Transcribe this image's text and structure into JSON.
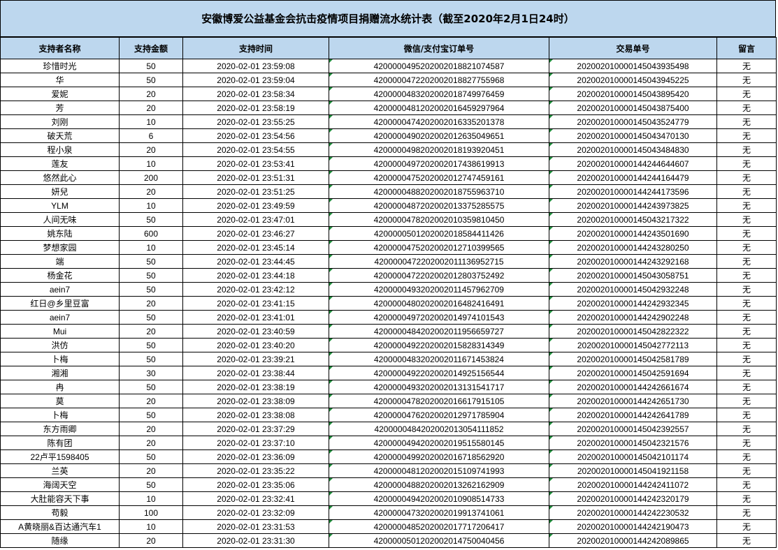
{
  "title": "安徽博爱公益基金会抗击疫情项目捐赠流水统计表（截至2020年2月1日24时）",
  "columns": [
    "支持者名称",
    "支持金额",
    "支持时间",
    "微信/支付宝订单号",
    "交易单号",
    "留言"
  ],
  "rows": [
    [
      "珍惜时光",
      "50",
      "2020-02-01 23:59:08",
      "4200000495202002018821074587",
      "2020020100001450439354​98",
      "无"
    ],
    [
      "华",
      "50",
      "2020-02-01 23:59:04",
      "4200000472202002018827755968",
      "20200201000014504394522​5",
      "无"
    ],
    [
      "爱妮",
      "20",
      "2020-02-01 23:58:34",
      "4200000483202002018749976459",
      "202002010000145043895420",
      "无"
    ],
    [
      "芳",
      "20",
      "2020-02-01 23:58:19",
      "4200000481202002016459297964",
      "202002010000145043875400",
      "无"
    ],
    [
      "刘刚",
      "10",
      "2020-02-01 23:55:25",
      "4200000474202002016335201378",
      "202002010000145043524779",
      "无"
    ],
    [
      "破天荒",
      "6",
      "2020-02-01 23:54:56",
      "4200000490202002012635049651",
      "202002010000145043470130",
      "无"
    ],
    [
      "程小泉",
      "20",
      "2020-02-01 23:54:55",
      "4200000498202002018193920451",
      "202002010000145043484830",
      "无"
    ],
    [
      "莲友",
      "10",
      "2020-02-01 23:53:41",
      "4200000497202002017438619913",
      "202002010000144244644607",
      "无"
    ],
    [
      "悠然此心",
      "200",
      "2020-02-01 23:51:31",
      "4200000475202002012747459161",
      "202002010000144244164479",
      "无"
    ],
    [
      "妍兒",
      "20",
      "2020-02-01 23:51:25",
      "4200000488202002018755963710",
      "202002010000144244173596",
      "无"
    ],
    [
      "YLM",
      "10",
      "2020-02-01 23:49:59",
      "4200000487202002013375285575",
      "202002010000144243973825",
      "无"
    ],
    [
      "人间无味",
      "50",
      "2020-02-01 23:47:01",
      "4200000478202002010359810450",
      "202002010000145043217322",
      "无"
    ],
    [
      "姚东陆",
      "600",
      "2020-02-01 23:46:27",
      "4200000501202002018584411426",
      "202002010000144243501690",
      "无"
    ],
    [
      "梦想家园",
      "10",
      "2020-02-01 23:45:14",
      "4200000475202002012710399565",
      "202002010000144243280250",
      "无"
    ],
    [
      "端",
      "50",
      "2020-02-01 23:44:45",
      "4200000472202002011136952715",
      "202002010000144243292168",
      "无"
    ],
    [
      "杨金花",
      "50",
      "2020-02-01 23:44:18",
      "4200000472202002012803752492",
      "202002010000145043058751",
      "无"
    ],
    [
      "aein7",
      "50",
      "2020-02-01 23:42:12",
      "4200000493202002011457962709",
      "202002010000145042932248",
      "无"
    ],
    [
      "红日@乡里豆富",
      "20",
      "2020-02-01 23:41:15",
      "4200000480202002016482416491",
      "202002010000144242932345",
      "无"
    ],
    [
      "aein7",
      "50",
      "2020-02-01 23:41:01",
      "4200000497202002014974101543",
      "202002010000144242902248",
      "无"
    ],
    [
      "Mui",
      "20",
      "2020-02-01 23:40:59",
      "4200000484202002011956659727",
      "202002010000145042822322",
      "无"
    ],
    [
      "洪仿",
      "50",
      "2020-02-01 23:40:20",
      "4200000492202002015828314349",
      "202002010000145042772113",
      "无"
    ],
    [
      "卜梅",
      "50",
      "2020-02-01 23:39:21",
      "4200000483202002011671453824",
      "202002010000145042581789",
      "无"
    ],
    [
      "湘湘",
      "30",
      "2020-02-01 23:38:44",
      "4200000492202002014925156544",
      "202002010000145042591694",
      "无"
    ],
    [
      "冉",
      "50",
      "2020-02-01 23:38:19",
      "4200000493202002013131541717",
      "202002010000144242661674",
      "无"
    ],
    [
      "莫",
      "20",
      "2020-02-01 23:38:09",
      "4200000478202002016617915105",
      "202002010000144242651730",
      "无"
    ],
    [
      "卜梅",
      "50",
      "2020-02-01 23:38:08",
      "4200000476202002012971785904",
      "202002010000144242641789",
      "无"
    ],
    [
      "东方雨卿",
      "20",
      "2020-02-01 23:37:29",
      "4200000484202002013054111852",
      "202002010000145042392557",
      "无"
    ],
    [
      "陈有团",
      "20",
      "2020-02-01 23:37:10",
      "4200000494202002019515580145",
      "202002010000145042321576",
      "无"
    ],
    [
      "22卢平1598405",
      "50",
      "2020-02-01 23:36:09",
      "4200000499202002016718562920",
      "202002010000145042101174",
      "无"
    ],
    [
      "兰英",
      "20",
      "2020-02-01 23:35:22",
      "4200000481202002015109741993",
      "202002010000145041921158",
      "无"
    ],
    [
      "海阔天空",
      "50",
      "2020-02-01 23:35:06",
      "4200000488202002013262162909",
      "202002010000144242411072",
      "无"
    ],
    [
      "大肚能容天下事",
      "10",
      "2020-02-01 23:32:41",
      "4200000494202002010908514733",
      "202002010000144242320179",
      "无"
    ],
    [
      "苟毅",
      "100",
      "2020-02-01 23:32:09",
      "4200000473202002019913741061",
      "202002010000144242230532",
      "无"
    ],
    [
      "A黄晓丽&百达通汽车1",
      "10",
      "2020-02-01 23:31:53",
      "4200000485202002017717206417",
      "202002010000144242190473",
      "无"
    ],
    [
      "随缘",
      "20",
      "2020-02-01 23:31:30",
      "4200000501202002014750040456",
      "202002010000144242089865",
      "无"
    ]
  ]
}
